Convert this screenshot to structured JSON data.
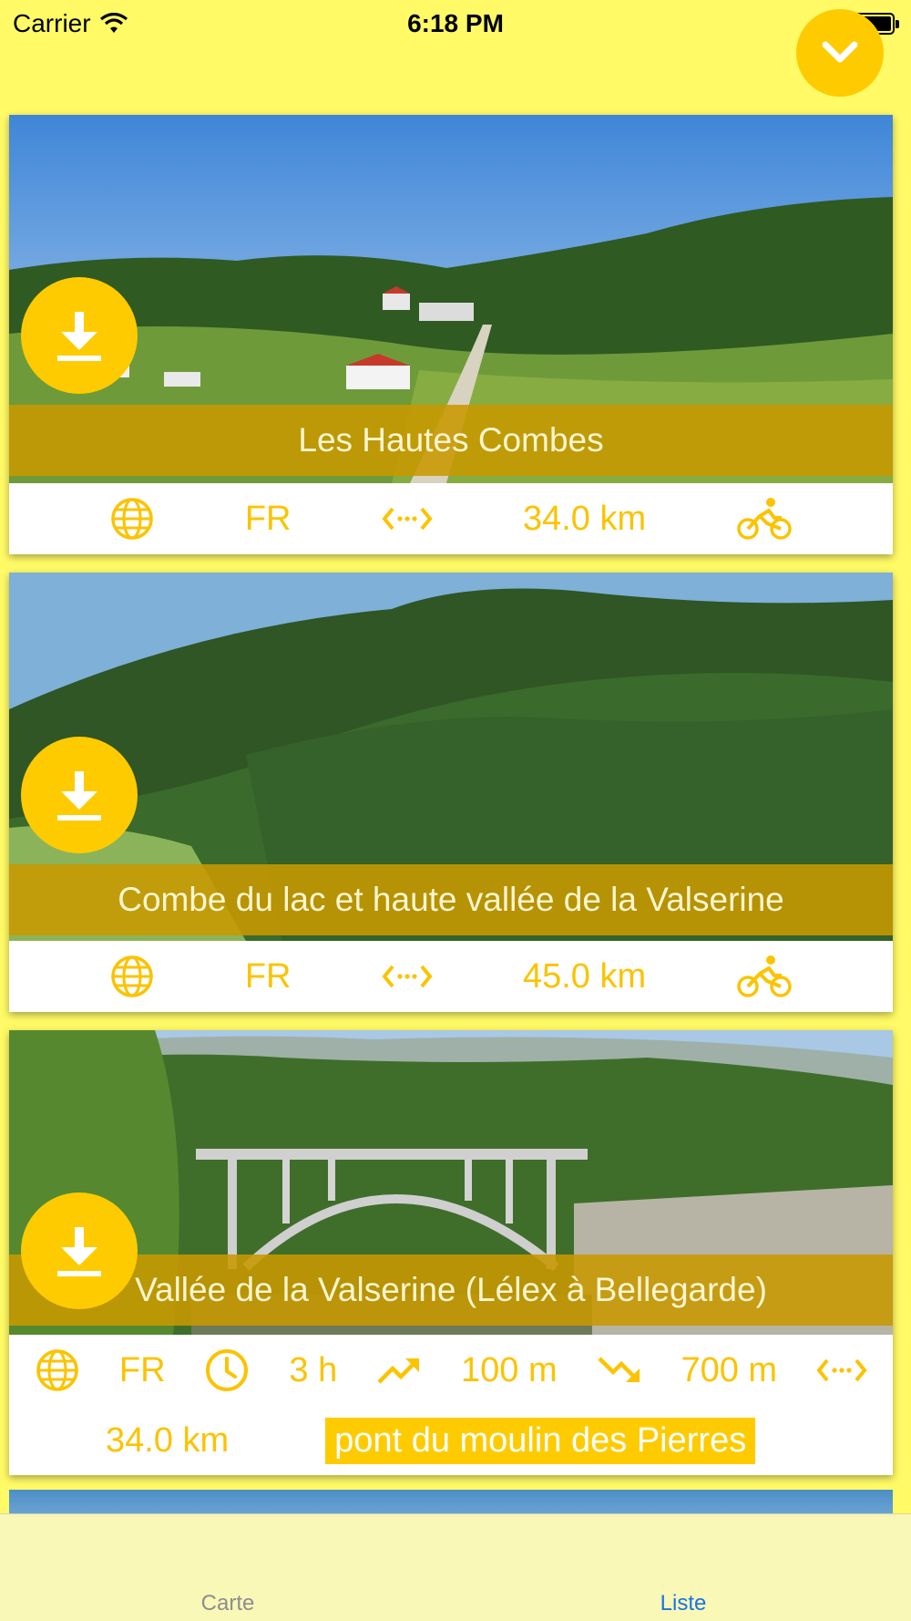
{
  "status_bar": {
    "carrier": "Carrier",
    "time": "6:18 PM"
  },
  "colors": {
    "background": "#fffa66",
    "accent": "#fecb00",
    "info_text": "#fbc300",
    "title_band": "#c89800",
    "tab_active": "#1a73e8",
    "tab_inactive": "#8e8e8e"
  },
  "routes": [
    {
      "title": "Les Hautes Combes",
      "language": "FR",
      "distance": "34.0 km",
      "activity_icon": "bicycle-icon"
    },
    {
      "title": "Combe du lac et haute vallée de la Valserine",
      "language": "FR",
      "distance": "45.0 km",
      "activity_icon": "bicycle-icon"
    },
    {
      "title": "Vallée de la Valserine (Lélex à Bellegarde)",
      "language": "FR",
      "duration": "3 h",
      "ascent": "100 m",
      "descent": "700 m",
      "distance": "34.0 km",
      "tag": "pont du moulin des Pierres"
    }
  ],
  "tabs": [
    {
      "label": "Carte",
      "active": false
    },
    {
      "label": "Liste",
      "active": true
    }
  ]
}
